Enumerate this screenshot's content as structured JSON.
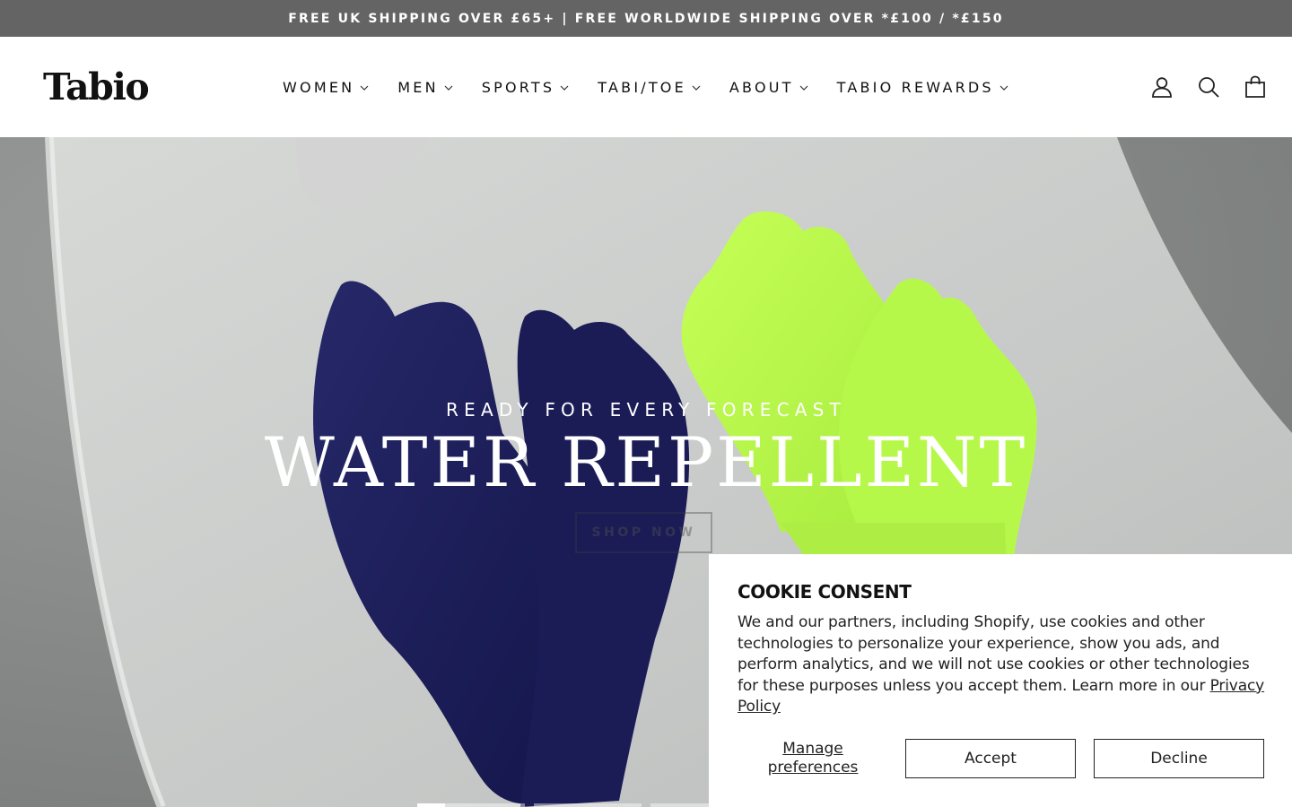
{
  "announcement": {
    "text": "FREE UK SHIPPING OVER £65+ | FREE WORLDWIDE SHIPPING OVER *£100 / *£150"
  },
  "header": {
    "logo": "Tabio",
    "nav": [
      {
        "label": "WOMEN"
      },
      {
        "label": "MEN"
      },
      {
        "label": "SPORTS"
      },
      {
        "label": "TABI/TOE"
      },
      {
        "label": "ABOUT"
      },
      {
        "label": "TABIO REWARDS"
      }
    ],
    "icons": [
      "account-icon",
      "search-icon",
      "cart-icon"
    ]
  },
  "hero": {
    "subheading": "READY FOR EVERY FORECAST",
    "headline": "WATER REPELLENT",
    "cta": "SHOP NOW",
    "slides_count": 3,
    "active_slide": 1
  },
  "cookie": {
    "title": "COOKIE CONSENT",
    "body": "We and our partners, including Shopify, use cookies and other technologies to personalize your experience, show you ads, and perform analytics, and we will not use cookies or other technologies for these purposes unless you accept them. Learn more in our ",
    "link": "Privacy Policy",
    "manage": "Manage preferences",
    "accept": "Accept",
    "decline": "Decline"
  },
  "colors": {
    "announcement_bg": "#646464",
    "navy_sock": "#1e1f5e",
    "lime_sock": "#b8f54a"
  }
}
